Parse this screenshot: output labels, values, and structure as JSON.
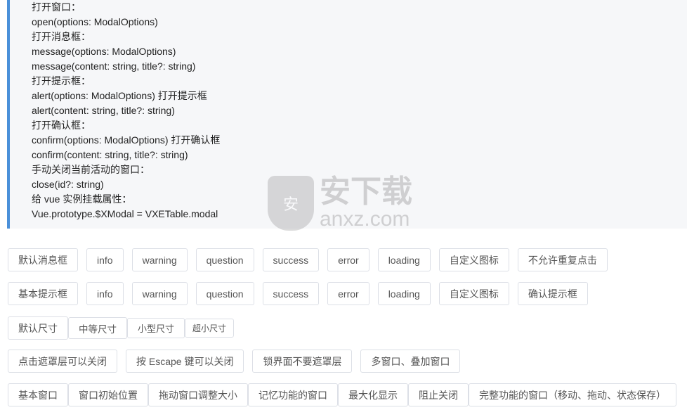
{
  "doc_lines": [
    "打开窗口：",
    "open(options: ModalOptions)",
    "打开消息框：",
    "message(options: ModalOptions)",
    "message(content: string, title?: string)",
    "打开提示框：",
    "alert(options: ModalOptions) 打开提示框",
    "alert(content: string, title?: string)",
    "打开确认框：",
    "confirm(options: ModalOptions) 打开确认框",
    "confirm(content: string, title?: string)",
    "手动关闭当前活动的窗口：",
    "close(id?: string)",
    "给 vue 实例挂载属性：",
    "Vue.prototype.$XModal = VXETable.modal"
  ],
  "accent_color": "#4a90d9",
  "watermark": {
    "icon": "shield-icon",
    "glyph": "安",
    "cn": "安下载",
    "en": "anxz.com"
  },
  "rows": {
    "message": [
      "默认消息框",
      "info",
      "warning",
      "question",
      "success",
      "error",
      "loading",
      "自定义图标",
      "不允许重复点击"
    ],
    "alert": [
      "基本提示框",
      "info",
      "warning",
      "question",
      "success",
      "error",
      "loading",
      "自定义图标",
      "确认提示框"
    ],
    "sizes": [
      "默认尺寸",
      "中等尺寸",
      "小型尺寸",
      "超小尺寸"
    ],
    "mask": [
      "点击遮罩层可以关闭",
      "按 Escape 键可以关闭",
      "锁界面不要遮罩层",
      "多窗口、叠加窗口"
    ],
    "window": [
      "基本窗口",
      "窗口初始位置",
      "拖动窗口调整大小",
      "记忆功能的窗口",
      "最大化显示",
      "阻止关闭",
      "完整功能的窗口（移动、拖动、状态保存）"
    ]
  }
}
